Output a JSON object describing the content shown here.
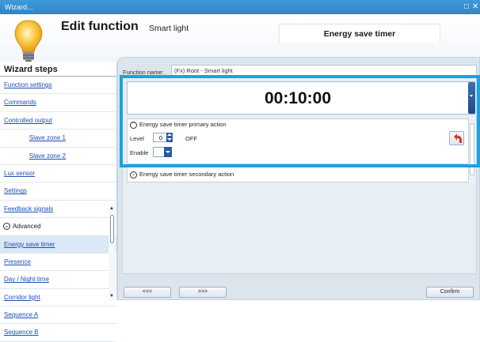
{
  "window": {
    "title": "Wizard...",
    "controls": [
      "□",
      "✕"
    ]
  },
  "header": {
    "title": "Edit function",
    "subtitle": "Smart light",
    "tab": "Energy save timer"
  },
  "sidebar": {
    "title": "Wizard steps",
    "items": [
      {
        "label": "Function settings",
        "indent": false
      },
      {
        "label": "Commands",
        "indent": false
      },
      {
        "label": "Controlled output",
        "indent": false
      },
      {
        "label": "Slave zone 1",
        "indent": true
      },
      {
        "label": "Slave zone 2",
        "indent": true
      },
      {
        "label": "Lux sensor",
        "indent": false
      },
      {
        "label": "Settings",
        "indent": false
      },
      {
        "label": "Feedback signals",
        "indent": false
      }
    ],
    "advanced_label": "Advanced",
    "advanced_items": [
      {
        "label": "Energy save timer",
        "selected": true
      },
      {
        "label": "Presence",
        "selected": false
      },
      {
        "label": "Day / Night time",
        "selected": false
      },
      {
        "label": "Corridor light",
        "selected": false
      },
      {
        "label": "Sequence A",
        "selected": false
      },
      {
        "label": "Sequence B",
        "selected": false
      }
    ]
  },
  "main": {
    "function_name_label": "Function name:",
    "function_name_value": "(Fx) Root - Smart light",
    "timer_value": "00:10:00",
    "primary": {
      "title": "Energy save timer primary action",
      "level_label": "Level",
      "level_value": "0",
      "level_text": "OFF",
      "enable_label": "Enable"
    },
    "secondary_title": "Energy save timer secondary action"
  },
  "footer": {
    "prev_label": "<<<",
    "next_label": ">>>",
    "confirm_label": "Confirm"
  },
  "colors": {
    "accent": "#1aa3e3",
    "titlebar": "#3a92d4",
    "link": "#1b4fb5"
  }
}
